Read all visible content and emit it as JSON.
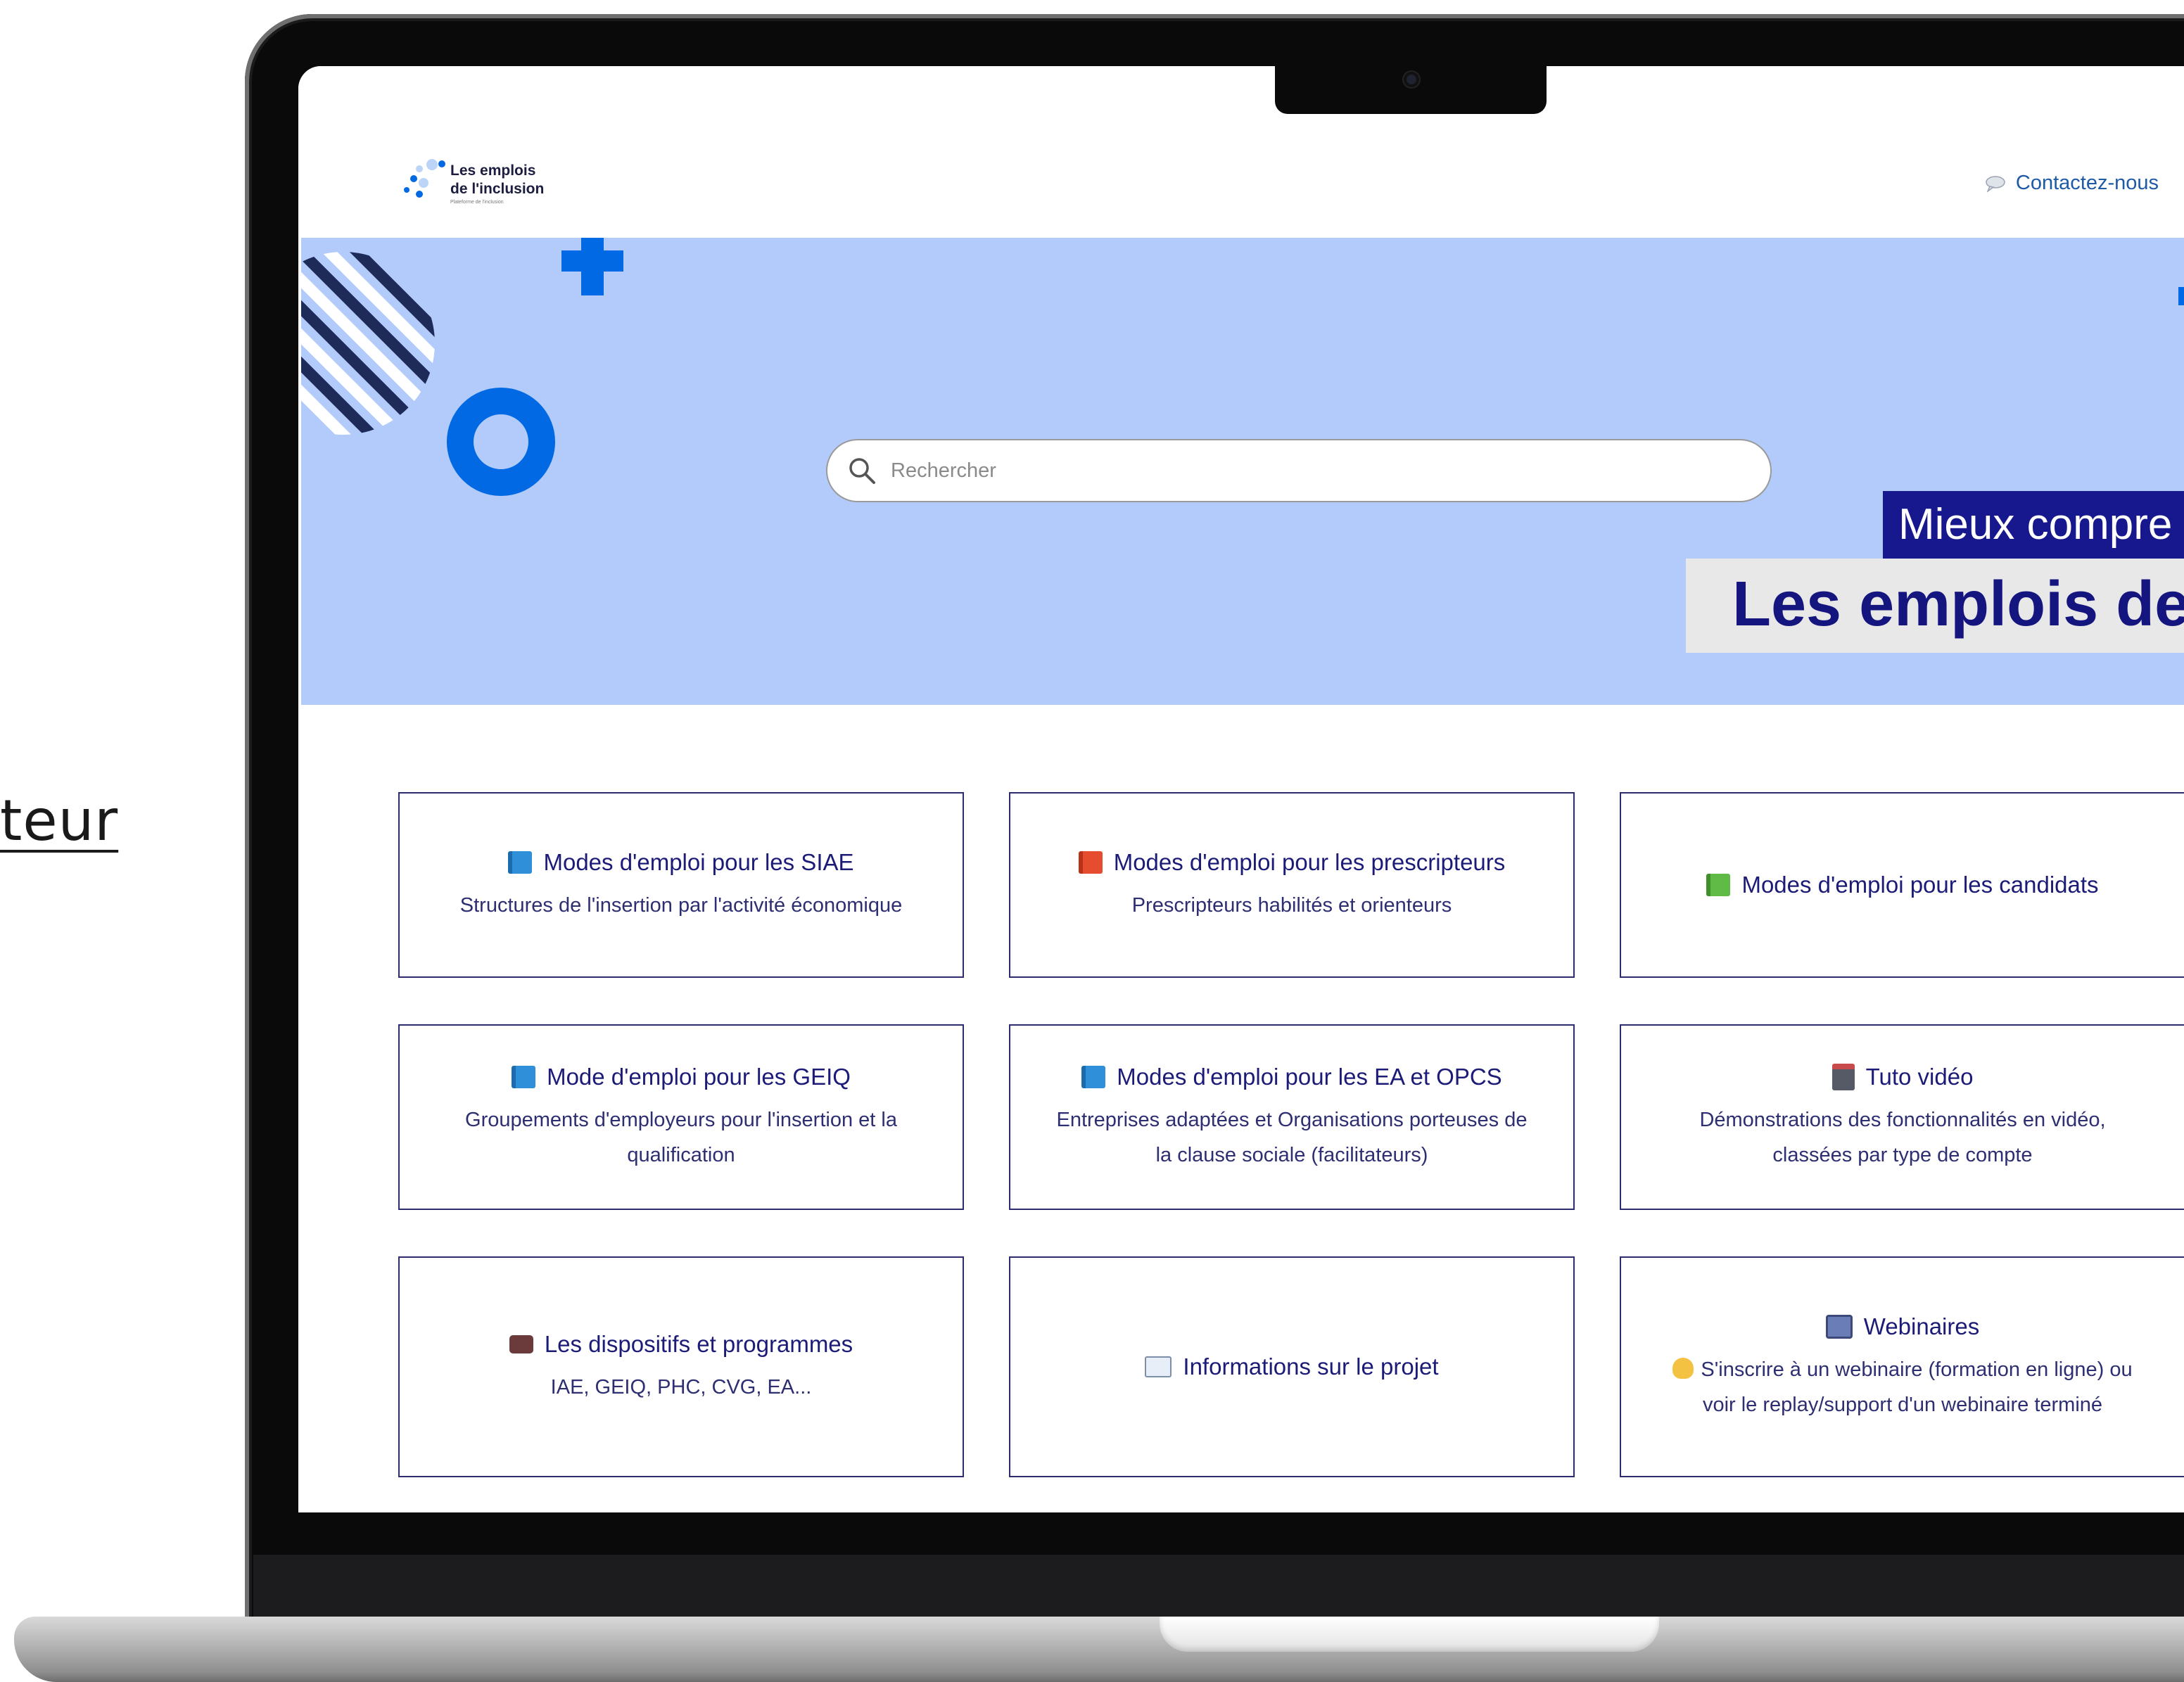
{
  "outside": {
    "left_link_fragment": "teur"
  },
  "header": {
    "logo_title": "Les emplois\nde l'inclusion",
    "logo_sub": "Plateforme de l'inclusion",
    "contact_label": "Contactez-nous"
  },
  "hero": {
    "search_placeholder": "Rechercher",
    "banner_top": "Mieux compre",
    "banner_bottom": "Les emplois de"
  },
  "colors": {
    "hero_bg": "#b3cbfb",
    "brand_blue": "#0069e3",
    "navy": "#18188e",
    "card_border": "#2c2c6e"
  },
  "cards": [
    {
      "icon": "blue-book-icon",
      "title": "Modes d'emploi pour les SIAE",
      "subtitle": "Structures de l'insertion par l'activité économique"
    },
    {
      "icon": "red-book-icon",
      "title": "Modes d'emploi pour les prescripteurs",
      "subtitle": "Prescripteurs habilités et orienteurs"
    },
    {
      "icon": "green-book-icon",
      "title": "Modes d'emploi pour les candidats",
      "subtitle": ""
    },
    {
      "icon": "blue-book-icon",
      "title": "Mode d'emploi pour les GEIQ",
      "subtitle": "Groupements d'employeurs pour l'insertion et la qualification"
    },
    {
      "icon": "blue-book-icon",
      "title": "Modes d'emploi pour les EA et OPCS",
      "subtitle": "Entreprises adaptées et Organisations porteuses de la clause sociale (facilitateurs)"
    },
    {
      "icon": "clapper-icon",
      "title": "Tuto vidéo",
      "subtitle": "Démonstrations des fonctionnalités en vidéo, classées par type de compte"
    },
    {
      "icon": "briefcase-icon",
      "title": "Les dispositifs et programmes",
      "subtitle": "IAE, GEIQ, PHC, CVG, EA..."
    },
    {
      "icon": "open-book-icon",
      "title": "Informations sur le projet",
      "subtitle": ""
    },
    {
      "icon": "tv-icon",
      "title": "Webinaires",
      "subtitle_icon": "raising-hand-icon",
      "subtitle": "S'inscrire à un webinaire (formation en ligne) ou voir le replay/support d'un webinaire terminé"
    }
  ]
}
